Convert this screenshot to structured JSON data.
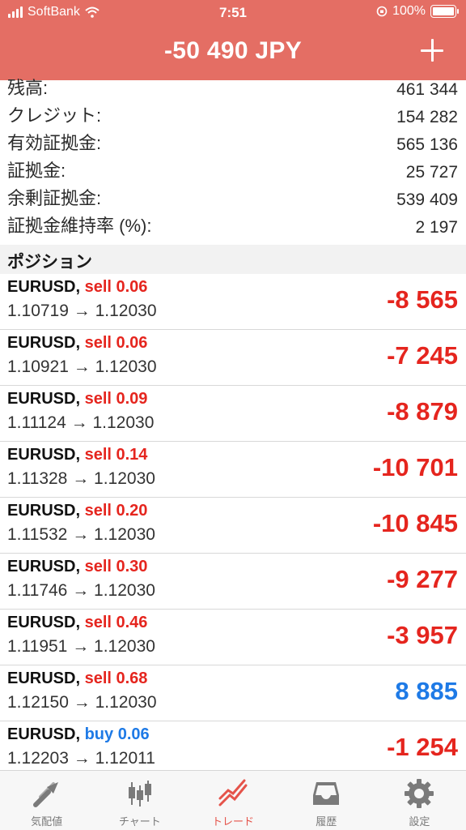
{
  "status_bar": {
    "carrier": "SoftBank",
    "time": "7:51",
    "battery": "100%"
  },
  "header": {
    "title": "-50 490 JPY"
  },
  "summary": [
    {
      "label": "残高:",
      "value": "461 344"
    },
    {
      "label": "クレジット:",
      "value": "154 282"
    },
    {
      "label": "有効証拠金:",
      "value": "565 136"
    },
    {
      "label": "証拠金:",
      "value": "25 727"
    },
    {
      "label": "余剰証拠金:",
      "value": "539 409"
    },
    {
      "label": "証拠金維持率 (%):",
      "value": "2 197"
    }
  ],
  "positions_section": {
    "label": "ポジション"
  },
  "positions": [
    {
      "symbol": "EURUSD,",
      "side": "sell",
      "volume": "0.06",
      "open": "1.10719",
      "arrow": "→",
      "current": "1.12030",
      "profit": "-8 565"
    },
    {
      "symbol": "EURUSD,",
      "side": "sell",
      "volume": "0.06",
      "open": "1.10921",
      "arrow": "→",
      "current": "1.12030",
      "profit": "-7 245"
    },
    {
      "symbol": "EURUSD,",
      "side": "sell",
      "volume": "0.09",
      "open": "1.11124",
      "arrow": "→",
      "current": "1.12030",
      "profit": "-8 879"
    },
    {
      "symbol": "EURUSD,",
      "side": "sell",
      "volume": "0.14",
      "open": "1.11328",
      "arrow": "→",
      "current": "1.12030",
      "profit": "-10 701"
    },
    {
      "symbol": "EURUSD,",
      "side": "sell",
      "volume": "0.20",
      "open": "1.11532",
      "arrow": "→",
      "current": "1.12030",
      "profit": "-10 845"
    },
    {
      "symbol": "EURUSD,",
      "side": "sell",
      "volume": "0.30",
      "open": "1.11746",
      "arrow": "→",
      "current": "1.12030",
      "profit": "-9 277"
    },
    {
      "symbol": "EURUSD,",
      "side": "sell",
      "volume": "0.46",
      "open": "1.11951",
      "arrow": "→",
      "current": "1.12030",
      "profit": "-3 957"
    },
    {
      "symbol": "EURUSD,",
      "side": "sell",
      "volume": "0.68",
      "open": "1.12150",
      "arrow": "→",
      "current": "1.12030",
      "profit": "8 885"
    },
    {
      "symbol": "EURUSD,",
      "side": "buy",
      "volume": "0.06",
      "open": "1.12203",
      "arrow": "→",
      "current": "1.12011",
      "profit": "-1 254"
    }
  ],
  "tabs": [
    {
      "label": "気配値",
      "icon": "quotes-arrows-icon"
    },
    {
      "label": "チャート",
      "icon": "candlestick-chart-icon"
    },
    {
      "label": "トレード",
      "icon": "trade-trend-icon",
      "active": true
    },
    {
      "label": "履歴",
      "icon": "history-inbox-icon"
    },
    {
      "label": "設定",
      "icon": "settings-gear-icon"
    }
  ],
  "colors": {
    "header": "#e46e64",
    "loss": "#e5251e",
    "gain": "#1e7ae6",
    "tab_active": "#e5534a",
    "tab_inactive": "#7a7a7a"
  }
}
